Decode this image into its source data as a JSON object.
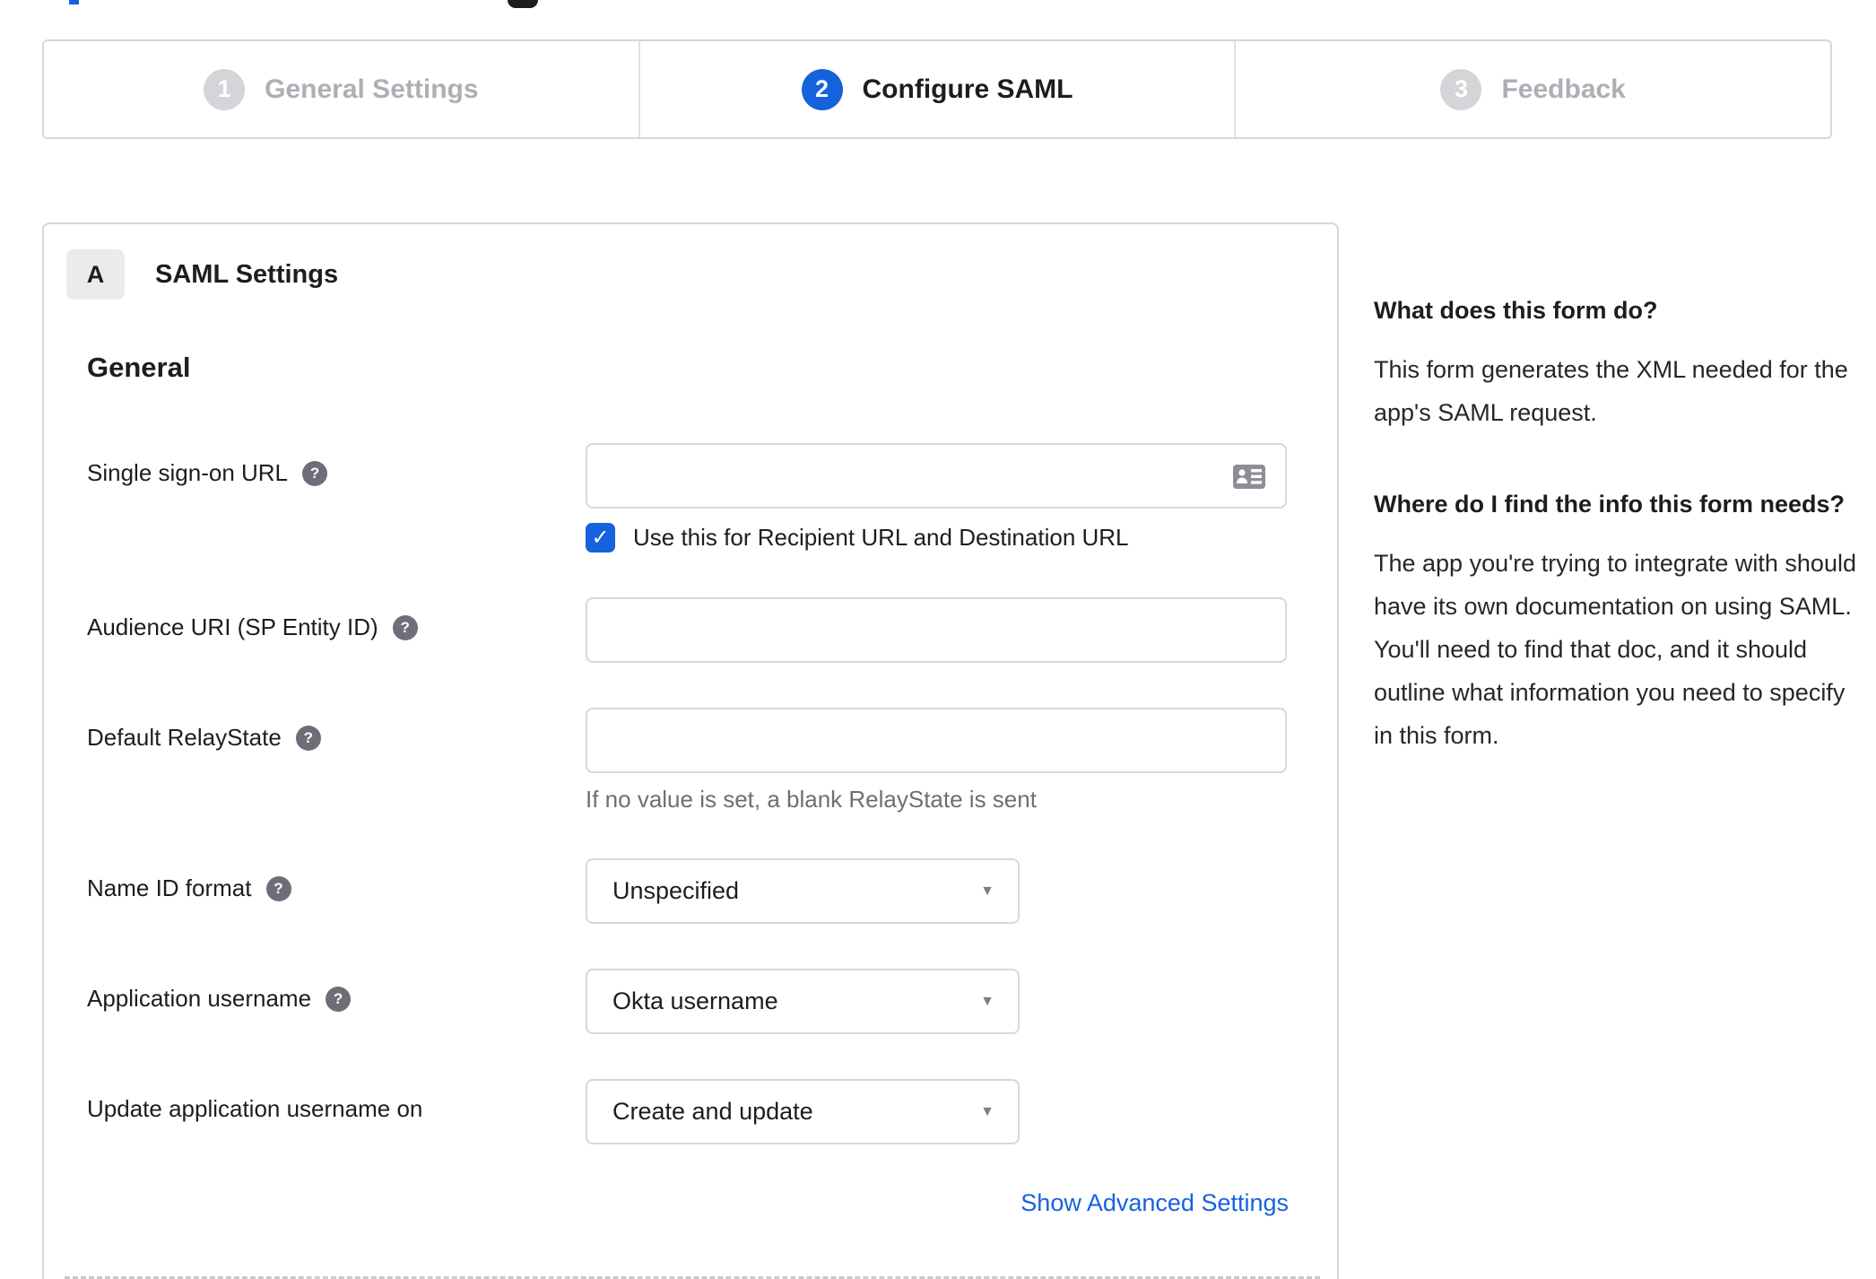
{
  "stepper": {
    "steps": [
      {
        "number": "1",
        "label": "General Settings",
        "state": "inactive"
      },
      {
        "number": "2",
        "label": "Configure SAML",
        "state": "active"
      },
      {
        "number": "3",
        "label": "Feedback",
        "state": "inactive"
      }
    ]
  },
  "panel": {
    "badge": "A",
    "title": "SAML Settings",
    "section_heading": "General",
    "fields": {
      "sso_url": {
        "label": "Single sign-on URL",
        "value": "",
        "checkbox_label": "Use this for Recipient URL and Destination URL",
        "checkbox_checked": true
      },
      "audience_uri": {
        "label": "Audience URI (SP Entity ID)",
        "value": ""
      },
      "relay_state": {
        "label": "Default RelayState",
        "value": "",
        "hint": "If no value is set, a blank RelayState is sent"
      },
      "name_id_format": {
        "label": "Name ID format",
        "value": "Unspecified"
      },
      "app_username": {
        "label": "Application username",
        "value": "Okta username"
      },
      "update_app_username": {
        "label": "Update application username on",
        "value": "Create and update"
      }
    },
    "advanced_link": "Show Advanced Settings"
  },
  "sidebar": {
    "sections": [
      {
        "heading": "What does this form do?",
        "body": "This form generates the XML needed for the app's SAML request."
      },
      {
        "heading": "Where do I find the info this form needs?",
        "body": "The app you're trying to integrate with should have its own documentation on using SAML. You'll need to find that doc, and it should outline what information you need to specify in this form."
      }
    ]
  },
  "icons": {
    "help_glyph": "?",
    "check_glyph": "✓",
    "caret_glyph": "▼"
  },
  "colors": {
    "accent_blue": "#1662dd",
    "border_gray": "#d7d7dc",
    "text_dark": "#1d1d21",
    "step_inactive_text": "#aeaeb5",
    "step_inactive_circle": "#d4d4d9",
    "hint_gray": "#6e6e78",
    "help_icon_bg": "#6e6e78",
    "badge_bg": "#ebebed"
  }
}
